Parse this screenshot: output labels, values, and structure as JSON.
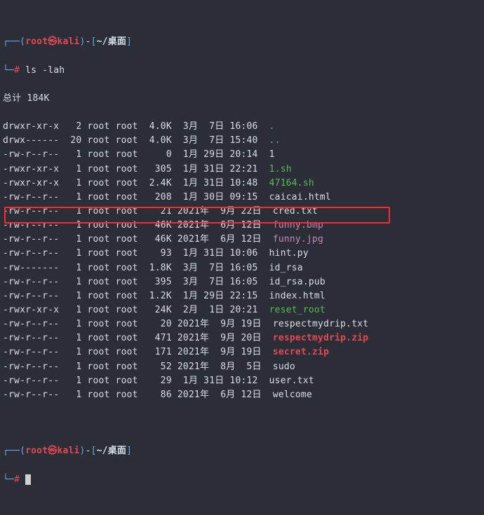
{
  "prompt1": {
    "arrow": "┌──",
    "open_paren": "(",
    "user": "root",
    "sep": "㉿",
    "host": "kali",
    "close_paren": ")",
    "dash": "-",
    "open_bracket": "[",
    "path": "~/桌面",
    "close_bracket": "]",
    "line2_arrow": "└─",
    "hash": "#",
    "cmd": "ls -lah"
  },
  "total_line": "总计 184K",
  "rows": [
    {
      "perm": "drwxr-xr-x",
      "links": "2",
      "owner": "root",
      "group": "root",
      "size": "4.0K",
      "date": " 3月  7日 16:06",
      "name": ".",
      "cls": "blue-light"
    },
    {
      "perm": "drwx------",
      "links": "20",
      "owner": "root",
      "group": "root",
      "size": "4.0K",
      "date": " 3月  7日 15:40",
      "name": "..",
      "cls": "blue-light"
    },
    {
      "perm": "-rw-r--r--",
      "links": "1",
      "owner": "root",
      "group": "root",
      "size": "0",
      "date": " 1月 29日 20:14",
      "name": "1",
      "cls": "white"
    },
    {
      "perm": "-rwxr-xr-x",
      "links": "1",
      "owner": "root",
      "group": "root",
      "size": "305",
      "date": " 1月 31日 22:21",
      "name": "1.sh",
      "cls": "green-txt"
    },
    {
      "perm": "-rwxr-xr-x",
      "links": "1",
      "owner": "root",
      "group": "root",
      "size": "2.4K",
      "date": " 1月 31日 10:48",
      "name": "47164.sh",
      "cls": "green-txt"
    },
    {
      "perm": "-rw-r--r--",
      "links": "1",
      "owner": "root",
      "group": "root",
      "size": "208",
      "date": " 1月 30日 09:15",
      "name": "caicai.html",
      "cls": "white"
    },
    {
      "perm": "-rw-r--r--",
      "links": "1",
      "owner": "root",
      "group": "root",
      "size": "21",
      "date": "2021年  9月 22日",
      "name": "cred.txt",
      "cls": "white"
    },
    {
      "perm": "-rw-r--r--",
      "links": "1",
      "owner": "root",
      "group": "root",
      "size": "46K",
      "date": "2021年  6月 12日",
      "name": "funny.bmp",
      "cls": "magenta-txt"
    },
    {
      "perm": "-rw-r--r--",
      "links": "1",
      "owner": "root",
      "group": "root",
      "size": "46K",
      "date": "2021年  6月 12日",
      "name": "funny.jpg",
      "cls": "magenta-txt"
    },
    {
      "perm": "-rw-r--r--",
      "links": "1",
      "owner": "root",
      "group": "root",
      "size": "93",
      "date": " 1月 31日 10:06",
      "name": "hint.py",
      "cls": "white"
    },
    {
      "perm": "-rw-------",
      "links": "1",
      "owner": "root",
      "group": "root",
      "size": "1.8K",
      "date": " 3月  7日 16:05",
      "name": "id_rsa",
      "cls": "white"
    },
    {
      "perm": "-rw-r--r--",
      "links": "1",
      "owner": "root",
      "group": "root",
      "size": "395",
      "date": " 3月  7日 16:05",
      "name": "id_rsa.pub",
      "cls": "white"
    },
    {
      "perm": "-rw-r--r--",
      "links": "1",
      "owner": "root",
      "group": "root",
      "size": "1.2K",
      "date": " 1月 29日 22:15",
      "name": "index.html",
      "cls": "white"
    },
    {
      "perm": "-rwxr-xr-x",
      "links": "1",
      "owner": "root",
      "group": "root",
      "size": "24K",
      "date": " 2月  1日 20:21",
      "name": "reset_root",
      "cls": "green-txt"
    },
    {
      "perm": "-rw-r--r--",
      "links": "1",
      "owner": "root",
      "group": "root",
      "size": "20",
      "date": "2021年  9月 19日",
      "name": "respectmydrip.txt",
      "cls": "white"
    },
    {
      "perm": "-rw-r--r--",
      "links": "1",
      "owner": "root",
      "group": "root",
      "size": "471",
      "date": "2021年  9月 20日",
      "name": "respectmydrip.zip",
      "cls": "red-file"
    },
    {
      "perm": "-rw-r--r--",
      "links": "1",
      "owner": "root",
      "group": "root",
      "size": "171",
      "date": "2021年  9月 19日",
      "name": "secret.zip",
      "cls": "red-file"
    },
    {
      "perm": "-rw-r--r--",
      "links": "1",
      "owner": "root",
      "group": "root",
      "size": "52",
      "date": "2021年  8月  5日",
      "name": "sudo",
      "cls": "white"
    },
    {
      "perm": "-rw-r--r--",
      "links": "1",
      "owner": "root",
      "group": "root",
      "size": "29",
      "date": " 1月 31日 10:12",
      "name": "user.txt",
      "cls": "white"
    },
    {
      "perm": "-rw-r--r--",
      "links": "1",
      "owner": "root",
      "group": "root",
      "size": "86",
      "date": "2021年  6月 12日",
      "name": "welcome",
      "cls": "white"
    }
  ],
  "prompt2": {
    "arrow": "┌──",
    "open_paren": "(",
    "user": "root",
    "sep": "㉿",
    "host": "kali",
    "close_paren": ")",
    "dash": "-",
    "open_bracket": "[",
    "path": "~/桌面",
    "close_bracket": "]",
    "line2_arrow": "└─",
    "hash": "#"
  }
}
